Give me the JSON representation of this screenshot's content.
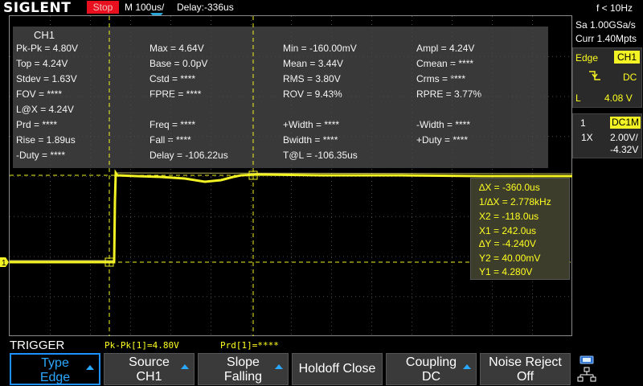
{
  "topbar": {
    "logo": "SIGLENT",
    "run_state": "Stop",
    "timebase": "M 100us/",
    "delay": "Delay:-336us"
  },
  "measurements": {
    "channel": "CH1",
    "rows": [
      [
        "Pk-Pk = 4.80V",
        "Max = 4.64V",
        "Min = -160.00mV",
        "Ampl = 4.24V"
      ],
      [
        "Top = 4.24V",
        "Base = 0.0pV",
        "Mean = 3.44V",
        "Cmean = ****"
      ],
      [
        "Stdev = 1.63V",
        "Cstd = ****",
        "RMS = 3.80V",
        "Crms = ****"
      ],
      [
        "FOV = ****",
        "FPRE = ****",
        "ROV = 9.43%",
        "RPRE = 3.77%"
      ],
      [
        "L@X = 4.24V",
        "",
        "",
        ""
      ],
      [
        "Prd = ****",
        "Freq = ****",
        "+Width = ****",
        "-Width = ****"
      ],
      [
        "Rise = 1.89us",
        "Fall = ****",
        "Bwidth = ****",
        "+Duty = ****"
      ],
      [
        "-Duty = ****",
        "Delay = -106.22us",
        "T@L = -106.35us",
        ""
      ]
    ]
  },
  "cursors": {
    "dx": "∆X = -360.0us",
    "inv_dx": "1/∆X = 2.778kHz",
    "x2": "X2 = -118.0us",
    "x1": "X1 = 242.0us",
    "dy": "∆Y = -4.240V",
    "y2": "Y2 = 40.00mV",
    "y1": "Y1 = 4.280V"
  },
  "channel_marker": "1",
  "right_panel": {
    "freq": "f < 10Hz",
    "sample_rate": "Sa 1.00GSa/s",
    "memory": "Curr 1.40Mpts",
    "trigger": {
      "type": "Edge",
      "source": "CH1",
      "slope_icon": "falling-edge-icon",
      "coupling": "DC",
      "level_label": "L",
      "level": "4.08 V"
    },
    "channel": {
      "number": "1",
      "coupling": "DC1M",
      "probe": "1X",
      "scale": "2.00V/",
      "offset": "-4.32V"
    }
  },
  "status": {
    "menu_title": "TRIGGER",
    "pkpk": "Pk-Pk[1]=4.80V",
    "prd": "Prd[1]=****"
  },
  "softkeys": [
    {
      "line1": "Type",
      "line2": "Edge",
      "active": true
    },
    {
      "line1": "Source",
      "line2": "CH1",
      "active": false
    },
    {
      "line1": "Slope",
      "line2": "Falling",
      "active": false
    },
    {
      "line1": "Holdoff Close",
      "line2": "",
      "active": false
    },
    {
      "line1": "Coupling",
      "line2": "DC",
      "active": false
    },
    {
      "line1": "Noise Reject",
      "line2": "Off",
      "active": false
    }
  ],
  "colors": {
    "trace": "#f2f224",
    "accent": "#1e90ff",
    "stop": "#e8101e"
  }
}
